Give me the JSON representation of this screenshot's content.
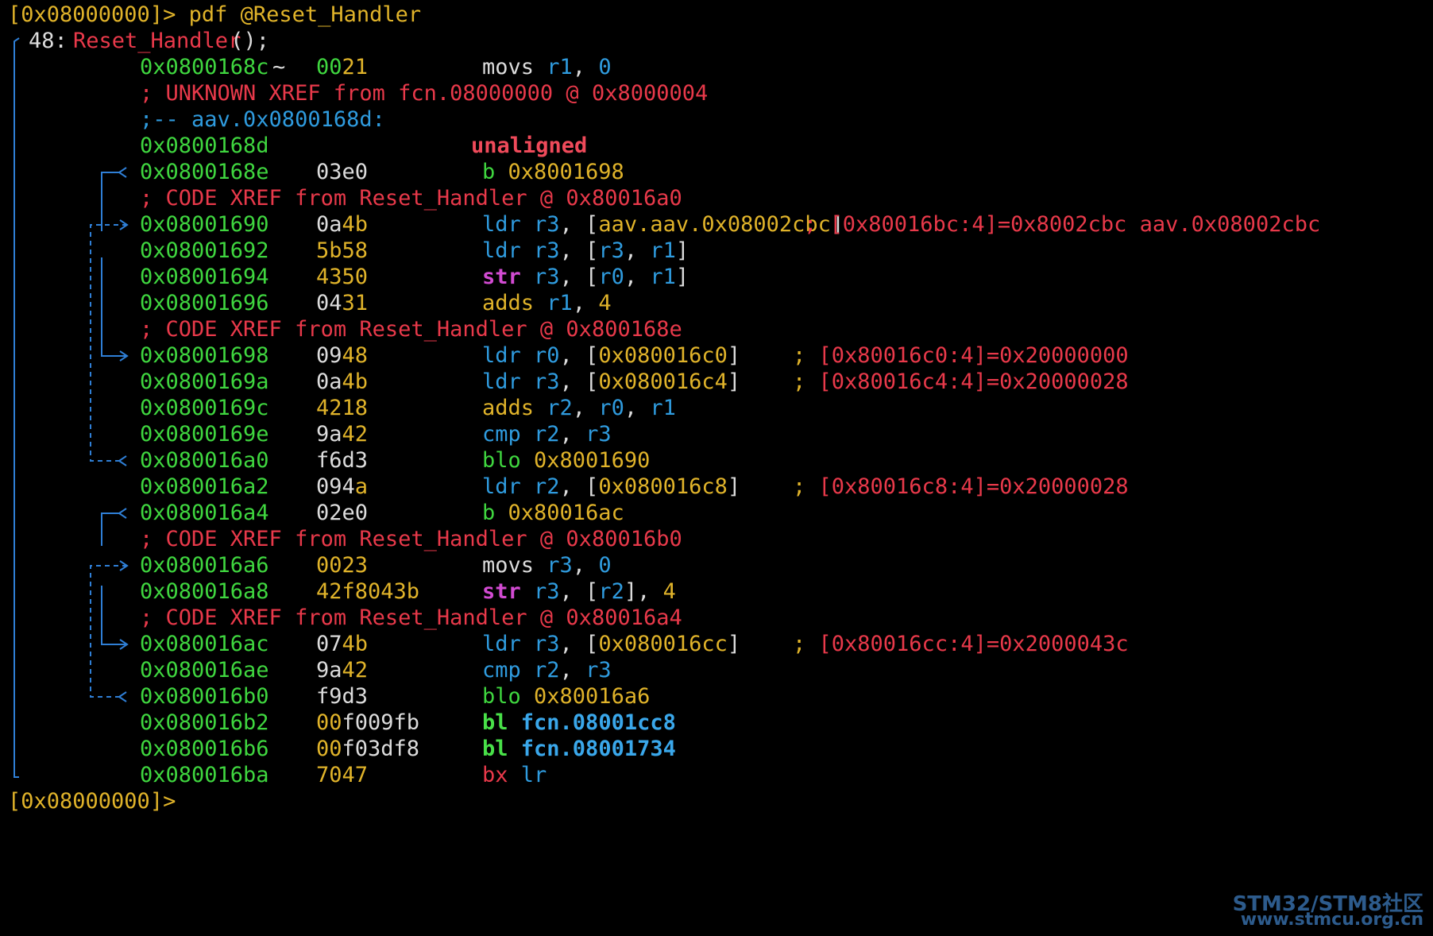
{
  "terminal": {
    "prompt_command": "[0x08000000]> pdf @Reset_Handler",
    "func_index": "48: ",
    "func_name": "Reset_Handler",
    "func_args": " ();",
    "final_prompt": "[0x08000000]>",
    "lines": [
      {
        "addr": "0x0800168c",
        "marker": "~",
        "bytes": [
          [
            "00",
            "green"
          ],
          [
            "21",
            "yellow"
          ]
        ],
        "ins": [
          [
            "movs ",
            "default"
          ],
          [
            "r1",
            "blue"
          ],
          [
            ", ",
            "default"
          ],
          [
            "0",
            "blue"
          ]
        ]
      },
      {
        "full": [
          [
            "; UNKNOWN XREF from fcn.08000000 @ 0x8000004",
            "red"
          ]
        ]
      },
      {
        "full": [
          [
            ";-- aav.0x0800168d:",
            "blue"
          ]
        ]
      },
      {
        "addr": "0x0800168d",
        "bytes": [],
        "ins": [
          [
            "unaligned",
            "redbold"
          ]
        ],
        "ins_indent": true
      },
      {
        "addr": "0x0800168e",
        "bytes": [
          [
            "03e0",
            "default"
          ]
        ],
        "ins": [
          [
            "b ",
            "green"
          ],
          [
            "0x8001698",
            "yellow"
          ]
        ]
      },
      {
        "full": [
          [
            "; CODE XREF from Reset_Handler @ 0x80016a0",
            "red"
          ]
        ]
      },
      {
        "addr": "0x08001690",
        "bytes": [
          [
            "0a",
            "default"
          ],
          [
            "4b",
            "yellow"
          ]
        ],
        "ins": [
          [
            "ldr ",
            "blue"
          ],
          [
            "r3",
            "blue"
          ],
          [
            ", [",
            "default"
          ],
          [
            "aav.aav.0x08002cbc",
            "yellow"
          ],
          [
            "]",
            "default"
          ]
        ],
        "comment": [
          [
            "; [0x80016bc:4]=0x8002cbc aav.0x08002cbc",
            "red"
          ]
        ],
        "comment_col": "near"
      },
      {
        "addr": "0x08001692",
        "bytes": [
          [
            "5b58",
            "yellow"
          ]
        ],
        "ins": [
          [
            "ldr ",
            "blue"
          ],
          [
            "r3",
            "blue"
          ],
          [
            ", [",
            "default"
          ],
          [
            "r3",
            "blue"
          ],
          [
            ", ",
            "default"
          ],
          [
            "r1",
            "blue"
          ],
          [
            "]",
            "default"
          ]
        ]
      },
      {
        "addr": "0x08001694",
        "bytes": [
          [
            "4350",
            "yellow"
          ]
        ],
        "ins": [
          [
            "str ",
            "magentabold"
          ],
          [
            "r3",
            "blue"
          ],
          [
            ", [",
            "default"
          ],
          [
            "r0",
            "blue"
          ],
          [
            ", ",
            "default"
          ],
          [
            "r1",
            "blue"
          ],
          [
            "]",
            "default"
          ]
        ]
      },
      {
        "addr": "0x08001696",
        "bytes": [
          [
            "04",
            "default"
          ],
          [
            "31",
            "yellow"
          ]
        ],
        "ins": [
          [
            "adds ",
            "yellow"
          ],
          [
            "r1",
            "blue"
          ],
          [
            ", ",
            "default"
          ],
          [
            "4",
            "yellow"
          ]
        ]
      },
      {
        "full": [
          [
            "; CODE XREF from Reset_Handler @ 0x800168e",
            "red"
          ]
        ]
      },
      {
        "addr": "0x08001698",
        "bytes": [
          [
            "09",
            "default"
          ],
          [
            "48",
            "yellow"
          ]
        ],
        "ins": [
          [
            "ldr ",
            "blue"
          ],
          [
            "r0",
            "blue"
          ],
          [
            ", [",
            "default"
          ],
          [
            "0x080016c0",
            "yellow"
          ],
          [
            "]",
            "default"
          ]
        ],
        "comment": [
          [
            "; ",
            "yellow"
          ],
          [
            "[0x80016c0:4]=0x20000000",
            "red"
          ]
        ]
      },
      {
        "addr": "0x0800169a",
        "bytes": [
          [
            "0a",
            "default"
          ],
          [
            "4b",
            "yellow"
          ]
        ],
        "ins": [
          [
            "ldr ",
            "blue"
          ],
          [
            "r3",
            "blue"
          ],
          [
            ", [",
            "default"
          ],
          [
            "0x080016c4",
            "yellow"
          ],
          [
            "]",
            "default"
          ]
        ],
        "comment": [
          [
            "; ",
            "yellow"
          ],
          [
            "[0x80016c4:4]=0x20000028",
            "red"
          ]
        ]
      },
      {
        "addr": "0x0800169c",
        "bytes": [
          [
            "4218",
            "yellow"
          ]
        ],
        "ins": [
          [
            "adds ",
            "yellow"
          ],
          [
            "r2",
            "blue"
          ],
          [
            ", ",
            "default"
          ],
          [
            "r0",
            "blue"
          ],
          [
            ", ",
            "default"
          ],
          [
            "r1",
            "blue"
          ]
        ]
      },
      {
        "addr": "0x0800169e",
        "bytes": [
          [
            "9a",
            "default"
          ],
          [
            "42",
            "yellow"
          ]
        ],
        "ins": [
          [
            "cmp ",
            "blue"
          ],
          [
            "r2",
            "blue"
          ],
          [
            ", ",
            "default"
          ],
          [
            "r3",
            "blue"
          ]
        ]
      },
      {
        "addr": "0x080016a0",
        "bytes": [
          [
            "f6d3",
            "default"
          ]
        ],
        "ins": [
          [
            "blo ",
            "green"
          ],
          [
            "0x8001690",
            "yellow"
          ]
        ]
      },
      {
        "addr": "0x080016a2",
        "bytes": [
          [
            "094",
            "default"
          ],
          [
            "a",
            "yellow"
          ]
        ],
        "ins": [
          [
            "ldr ",
            "blue"
          ],
          [
            "r2",
            "blue"
          ],
          [
            ", [",
            "default"
          ],
          [
            "0x080016c8",
            "yellow"
          ],
          [
            "]",
            "default"
          ]
        ],
        "comment": [
          [
            "; ",
            "yellow"
          ],
          [
            "[0x80016c8:4]=0x20000028",
            "red"
          ]
        ]
      },
      {
        "addr": "0x080016a4",
        "bytes": [
          [
            "02e0",
            "default"
          ]
        ],
        "ins": [
          [
            "b ",
            "green"
          ],
          [
            "0x80016ac",
            "yellow"
          ]
        ]
      },
      {
        "full": [
          [
            "; CODE XREF from Reset_Handler @ 0x80016b0",
            "red"
          ]
        ]
      },
      {
        "addr": "0x080016a6",
        "bytes": [
          [
            "0023",
            "yellow"
          ]
        ],
        "ins": [
          [
            "movs ",
            "default"
          ],
          [
            "r3",
            "blue"
          ],
          [
            ", ",
            "default"
          ],
          [
            "0",
            "blue"
          ]
        ]
      },
      {
        "addr": "0x080016a8",
        "bytes": [
          [
            "42f8043b",
            "yellow"
          ]
        ],
        "ins": [
          [
            "str ",
            "magentabold"
          ],
          [
            "r3",
            "blue"
          ],
          [
            ", [",
            "default"
          ],
          [
            "r2",
            "blue"
          ],
          [
            "], ",
            "default"
          ],
          [
            "4",
            "yellow"
          ]
        ]
      },
      {
        "full": [
          [
            "; CODE XREF from Reset_Handler @ 0x80016a4",
            "red"
          ]
        ]
      },
      {
        "addr": "0x080016ac",
        "bytes": [
          [
            "07",
            "default"
          ],
          [
            "4b",
            "yellow"
          ]
        ],
        "ins": [
          [
            "ldr ",
            "blue"
          ],
          [
            "r3",
            "blue"
          ],
          [
            ", [",
            "default"
          ],
          [
            "0x080016cc",
            "yellow"
          ],
          [
            "]",
            "default"
          ]
        ],
        "comment": [
          [
            "; ",
            "yellow"
          ],
          [
            "[0x80016cc:4]=0x2000043c",
            "red"
          ]
        ]
      },
      {
        "addr": "0x080016ae",
        "bytes": [
          [
            "9a",
            "default"
          ],
          [
            "42",
            "yellow"
          ]
        ],
        "ins": [
          [
            "cmp ",
            "blue"
          ],
          [
            "r2",
            "blue"
          ],
          [
            ", ",
            "default"
          ],
          [
            "r3",
            "blue"
          ]
        ]
      },
      {
        "addr": "0x080016b0",
        "bytes": [
          [
            "f9d3",
            "default"
          ]
        ],
        "ins": [
          [
            "blo ",
            "green"
          ],
          [
            "0x80016a6",
            "yellow"
          ]
        ]
      },
      {
        "addr": "0x080016b2",
        "bytes": [
          [
            "00",
            "yellow"
          ],
          [
            "f009fb",
            "default"
          ]
        ],
        "ins": [
          [
            "bl ",
            "greenbold"
          ],
          [
            "fcn.08001cc8",
            "bluebold"
          ]
        ]
      },
      {
        "addr": "0x080016b6",
        "bytes": [
          [
            "00",
            "yellow"
          ],
          [
            "f03df8",
            "default"
          ]
        ],
        "ins": [
          [
            "bl ",
            "greenbold"
          ],
          [
            "fcn.08001734",
            "bluebold"
          ]
        ]
      },
      {
        "addr": "0x080016ba",
        "bytes": [
          [
            "7047",
            "yellow"
          ]
        ],
        "ins": [
          [
            "bx ",
            "red"
          ],
          [
            "lr",
            "blue"
          ]
        ]
      }
    ]
  },
  "watermark": {
    "line1": "STM32/STM8社区",
    "line2": "www.stmcu.org.cn"
  },
  "colors": {
    "background": "#000000",
    "flow_arrow": "#2f7fd6",
    "prompt": "#e0b32a"
  }
}
